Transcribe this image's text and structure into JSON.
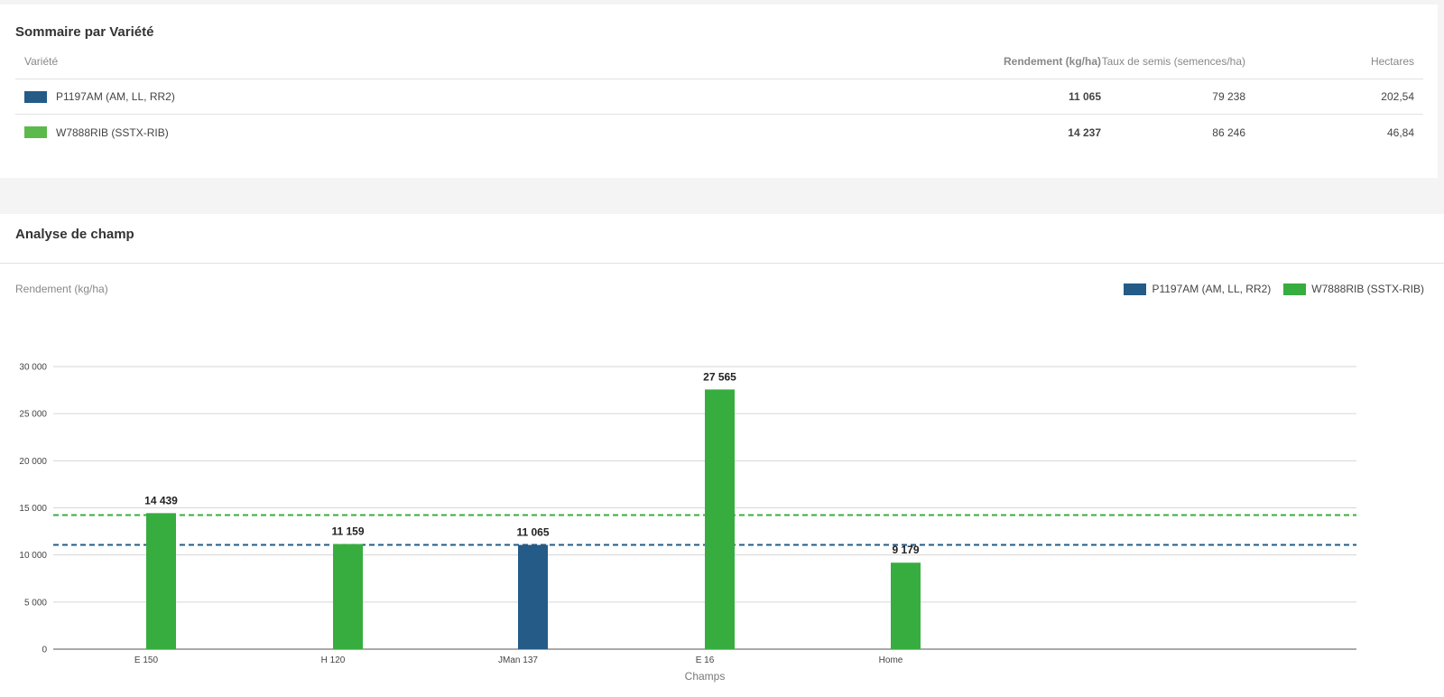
{
  "summary": {
    "title": "Sommaire par Variété",
    "columns": {
      "variety": "Variété",
      "yield": "Rendement (kg/ha)",
      "seeding": "Taux de semis (semences/ha)",
      "hectares": "Hectares"
    },
    "rows": [
      {
        "variety": "P1197AM (AM, LL, RR2)",
        "color": "#245b87",
        "yield": "11 065",
        "seeding": "79 238",
        "hectares": "202,54"
      },
      {
        "variety": "W7888RIB (SSTX-RIB)",
        "color": "#5cb94b",
        "yield": "14 237",
        "seeding": "86 246",
        "hectares": "46,84"
      }
    ]
  },
  "analysis": {
    "title": "Analyse de champ"
  },
  "chart_data": {
    "type": "bar",
    "ylabel": "Rendement (kg/ha)",
    "xlabel": "Champs",
    "ylim": [
      0,
      30000
    ],
    "yticks": [
      0,
      5000,
      10000,
      15000,
      20000,
      25000,
      30000
    ],
    "ytick_labels": [
      "0",
      "5 000",
      "10 000",
      "15 000",
      "20 000",
      "25 000",
      "30 000"
    ],
    "grid": true,
    "legend_position": "top-right",
    "categories": [
      "E 150",
      "H 120",
      "JMan 137",
      "E 16",
      "Home"
    ],
    "series": [
      {
        "name": "P1197AM (AM, LL, RR2)",
        "color": "#245b87",
        "values": [
          null,
          null,
          11065,
          null,
          null
        ],
        "average": 11065
      },
      {
        "name": "W7888RIB (SSTX-RIB)",
        "color": "#37ad3f",
        "values": [
          14439,
          11159,
          null,
          27565,
          9179
        ],
        "average": 14237
      }
    ],
    "bars": [
      {
        "category": "E 150",
        "series": "W7888RIB (SSTX-RIB)",
        "value": 14439,
        "label": "14 439"
      },
      {
        "category": "H 120",
        "series": "W7888RIB (SSTX-RIB)",
        "value": 11159,
        "label": "11 159"
      },
      {
        "category": "JMan 137",
        "series": "P1197AM (AM, LL, RR2)",
        "value": 11065,
        "label": "11 065"
      },
      {
        "category": "E 16",
        "series": "W7888RIB (SSTX-RIB)",
        "value": 27565,
        "label": "27 565"
      },
      {
        "category": "Home",
        "series": "W7888RIB (SSTX-RIB)",
        "value": 9179,
        "label": "9 179"
      }
    ]
  }
}
